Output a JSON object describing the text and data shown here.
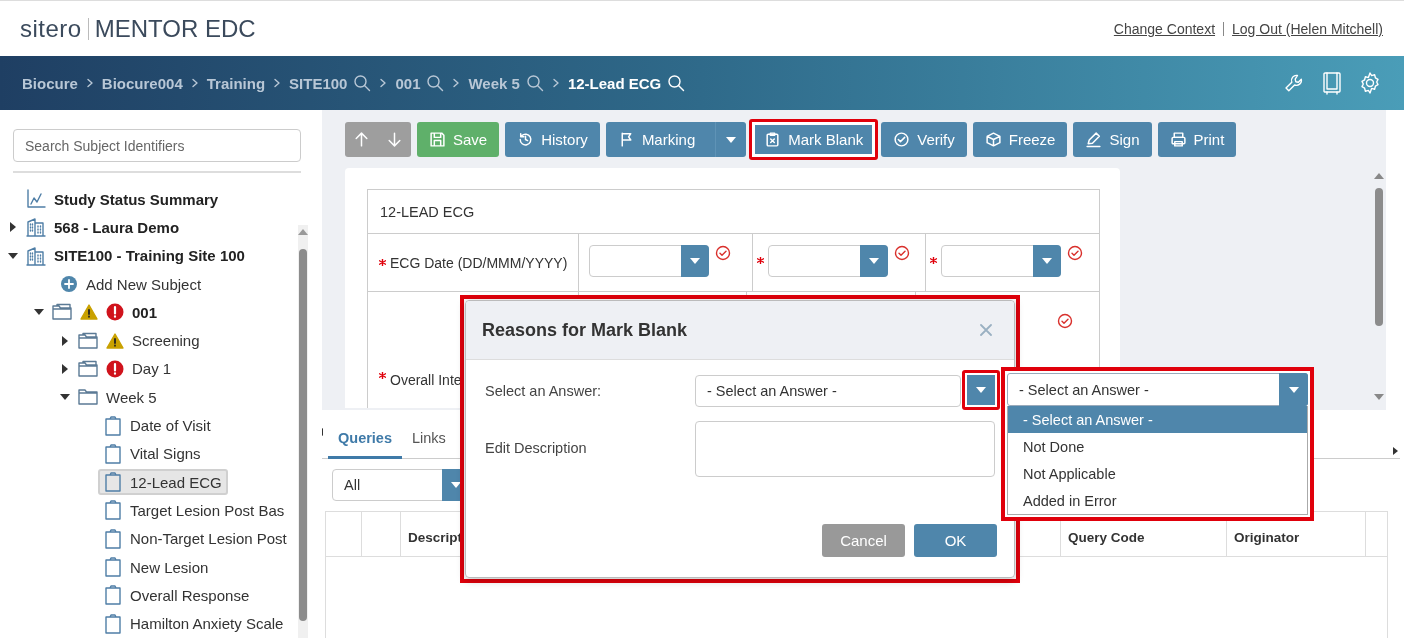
{
  "header": {
    "logo_brand": "sitero",
    "logo_product": "MENTOR EDC",
    "links": [
      "Change Context",
      "Log Out (Helen Mitchell)"
    ]
  },
  "breadcrumb": [
    {
      "label": "Biocure",
      "search": false,
      "current": false
    },
    {
      "label": "Biocure004",
      "search": false,
      "current": false
    },
    {
      "label": "Training",
      "search": false,
      "current": false
    },
    {
      "label": "SITE100",
      "search": true,
      "current": false
    },
    {
      "label": "001",
      "search": true,
      "current": false
    },
    {
      "label": "Week 5",
      "search": true,
      "current": false
    },
    {
      "label": "12-Lead ECG",
      "search": true,
      "current": true
    }
  ],
  "sidebar": {
    "search_placeholder": "Search Subject Identifiers",
    "tree": [
      {
        "label": "Study Status Summary",
        "kind": "summary",
        "selected": false
      },
      {
        "label": "568 - Laura Demo",
        "kind": "site",
        "expanded": false,
        "selected": false
      },
      {
        "label": "SITE100 - Training Site 100",
        "kind": "site",
        "expanded": true,
        "selected": false,
        "children": [
          {
            "label": "Add New Subject",
            "kind": "add",
            "selected": false
          },
          {
            "label": "001",
            "kind": "subject",
            "expanded": true,
            "warning": true,
            "error": true,
            "selected": false,
            "children": [
              {
                "label": "Screening",
                "kind": "visit",
                "expanded": false,
                "warning": true,
                "error": false,
                "selected": false
              },
              {
                "label": "Day 1",
                "kind": "visit",
                "expanded": false,
                "warning": false,
                "error": true,
                "selected": false
              },
              {
                "label": "Week 5",
                "kind": "visit",
                "expanded": true,
                "warning": false,
                "error": false,
                "selected": false,
                "children": [
                  {
                    "label": "Date of Visit",
                    "kind": "form",
                    "selected": false
                  },
                  {
                    "label": "Vital Signs",
                    "kind": "form",
                    "selected": false
                  },
                  {
                    "label": "12-Lead ECG",
                    "kind": "form",
                    "selected": true
                  },
                  {
                    "label": "Target Lesion Post Bas",
                    "kind": "form",
                    "selected": false
                  },
                  {
                    "label": "Non-Target Lesion Post",
                    "kind": "form",
                    "selected": false
                  },
                  {
                    "label": "New Lesion",
                    "kind": "form",
                    "selected": false
                  },
                  {
                    "label": "Overall Response",
                    "kind": "form",
                    "selected": false
                  },
                  {
                    "label": "Hamilton Anxiety Scale",
                    "kind": "form",
                    "selected": false
                  }
                ]
              }
            ]
          }
        ]
      }
    ]
  },
  "toolbar": [
    {
      "kind": "up",
      "disabled": true,
      "highlighted": false
    },
    {
      "kind": "down",
      "disabled": true,
      "highlighted": false
    },
    {
      "kind": "save",
      "label": "Save",
      "highlighted": false
    },
    {
      "kind": "history",
      "label": "History",
      "highlighted": false
    },
    {
      "kind": "marking",
      "label": "Marking",
      "highlighted": false
    },
    {
      "kind": "mark_blank",
      "label": "Mark Blank",
      "highlighted": true
    },
    {
      "kind": "verify",
      "label": "Verify",
      "highlighted": false
    },
    {
      "kind": "freeze",
      "label": "Freeze",
      "highlighted": false
    },
    {
      "kind": "sign",
      "label": "Sign",
      "highlighted": false
    },
    {
      "kind": "print",
      "label": "Print",
      "highlighted": false
    }
  ],
  "form": {
    "title": "12-LEAD ECG",
    "rows": [
      {
        "kind": "date",
        "label": "ECG Date (DD/MMM/YYYY)",
        "required": true,
        "fields": [
          {
            "required": false
          },
          {
            "required": true
          },
          {
            "required": true
          }
        ]
      },
      {
        "kind": "partial",
        "label": "Overall Inte",
        "required": true
      }
    ]
  },
  "bottom_panel": {
    "tabs": [
      {
        "label": "Queries",
        "selected": true
      },
      {
        "label": "Links",
        "selected": false
      }
    ],
    "filter": {
      "value": "All"
    },
    "table": {
      "columns": [
        {
          "label": "Descript"
        },
        {
          "label": "Query Code"
        },
        {
          "label": "Originator"
        }
      ]
    }
  },
  "dialog": {
    "title": "Reasons for Mark Blank",
    "highlighted": true,
    "fields": [
      {
        "kind": "select",
        "label": "Select an Answer:",
        "value": "- Select an Answer -",
        "arrow_highlighted": true
      },
      {
        "kind": "textarea",
        "label": "Edit Description"
      }
    ],
    "buttons": [
      {
        "kind": "secondary",
        "label": "Cancel"
      },
      {
        "kind": "primary",
        "label": "OK"
      }
    ]
  },
  "dropdown": {
    "value": "- Select an Answer -",
    "highlighted": true,
    "options": [
      {
        "label": "- Select an Answer -",
        "selected": true
      },
      {
        "label": "Not Done",
        "selected": false
      },
      {
        "label": "Not Applicable",
        "selected": false
      },
      {
        "label": "Added in Error",
        "selected": false
      }
    ]
  }
}
